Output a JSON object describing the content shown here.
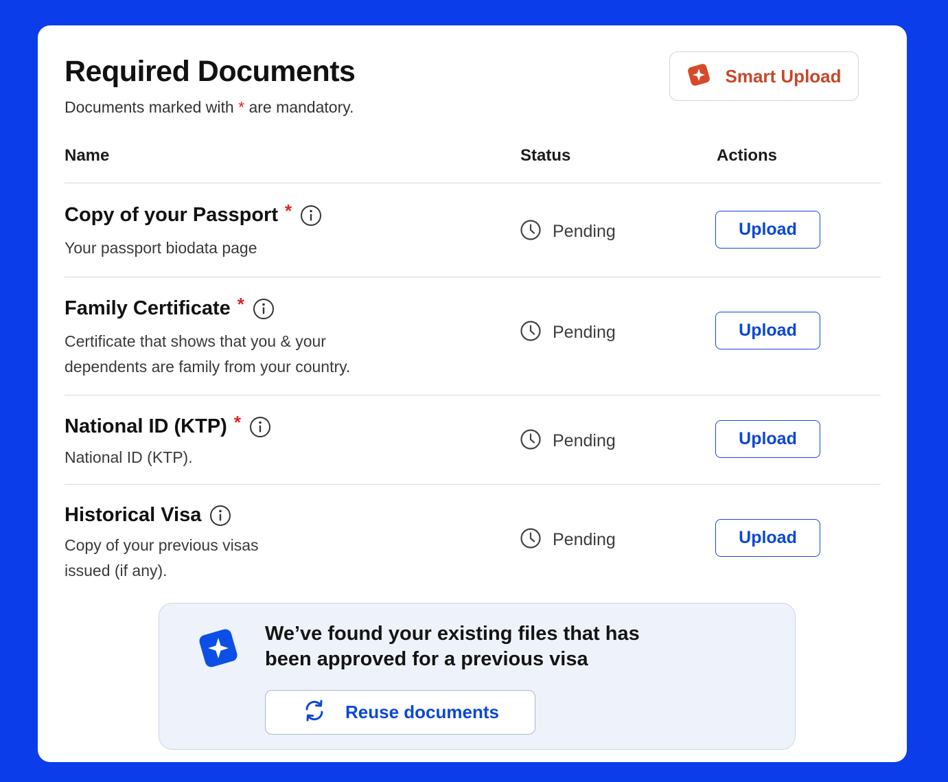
{
  "header": {
    "title": "Required Documents",
    "subtitle_before": "Documents marked with",
    "required_marker": "*",
    "subtitle_after": "are mandatory.",
    "smart_upload_label": "Smart Upload"
  },
  "table": {
    "columns": [
      "Name",
      "Status",
      "Actions"
    ],
    "rows": [
      {
        "name": "Copy of your Passport",
        "required": "*",
        "description": "Your passport biodata page",
        "status": "Pending",
        "action": "Upload"
      },
      {
        "name": "Family Certificate",
        "required": "*",
        "description": "Certificate that shows that you & your\ndependents are family from your country.",
        "status": "Pending",
        "action": "Upload"
      },
      {
        "name": "National ID (KTP)",
        "required": "*",
        "description": "National ID (KTP).",
        "status": "Pending",
        "action": "Upload"
      },
      {
        "name": "Historical Visa",
        "required": "",
        "description": "Copy of your previous visas\nissued (if any).",
        "status": "Pending",
        "action": "Upload"
      }
    ]
  },
  "banner": {
    "message": "We’ve found your existing files that has\nbeen approved for a previous visa",
    "reuse_label": "Reuse documents"
  },
  "icons": {
    "smart_upload": "sparkle-icon",
    "info": "info-icon",
    "status": "clock-icon",
    "banner": "sparkle-icon",
    "reuse": "refresh-icon"
  },
  "colors": {
    "background": "#0b3eea",
    "accent_blue": "#0b47d6",
    "smart_upload": "#c5482a",
    "required": "#e02424",
    "banner_bg": "#eef3fb"
  }
}
